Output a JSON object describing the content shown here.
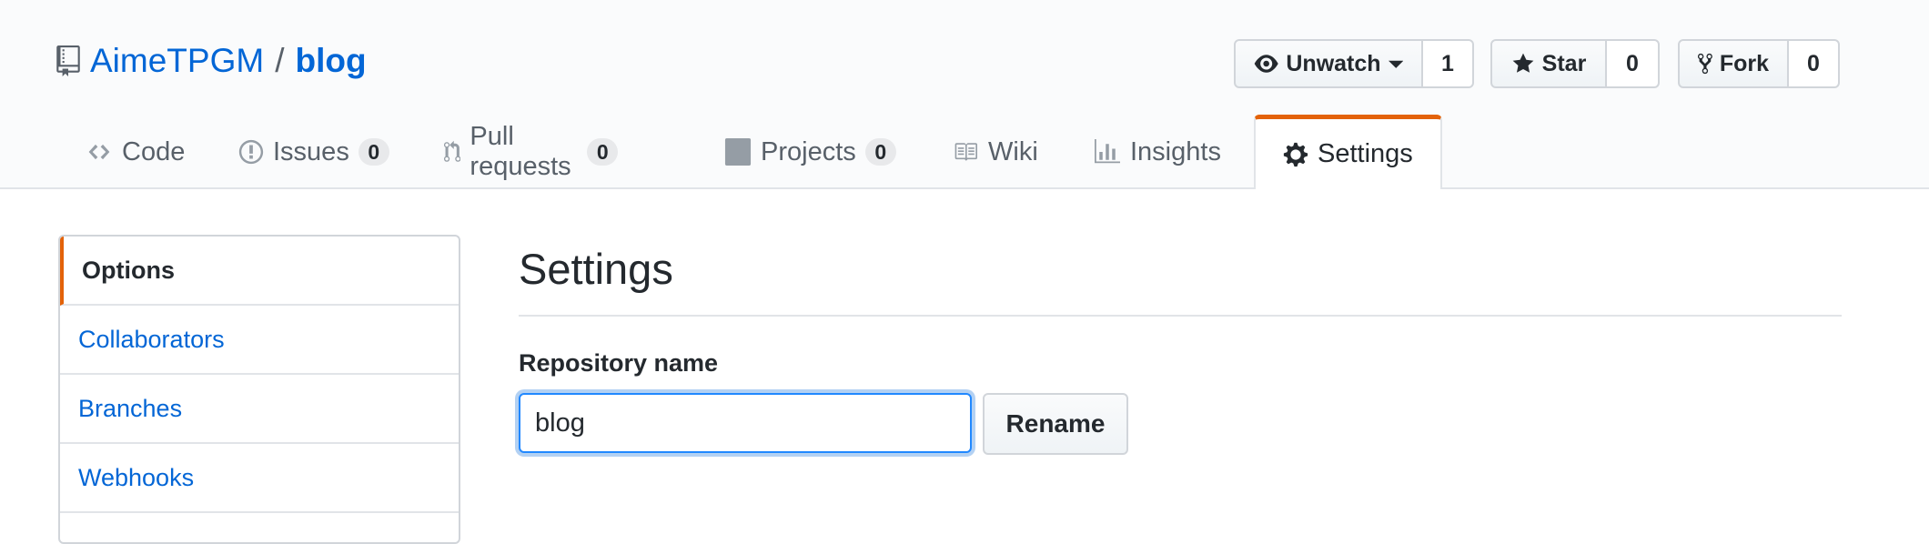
{
  "repo": {
    "owner": "AimeTPGM",
    "separator": "/",
    "name": "blog"
  },
  "actions": {
    "watch": {
      "label": "Unwatch",
      "count": "1"
    },
    "star": {
      "label": "Star",
      "count": "0"
    },
    "fork": {
      "label": "Fork",
      "count": "0"
    }
  },
  "tabs": [
    {
      "label": "Code",
      "icon": "code-icon"
    },
    {
      "label": "Issues",
      "count": "0",
      "icon": "issue-opened-icon"
    },
    {
      "label": "Pull requests",
      "count": "0",
      "icon": "git-pull-request-icon"
    },
    {
      "label": "Projects",
      "count": "0",
      "icon": "project-icon"
    },
    {
      "label": "Wiki",
      "icon": "book-icon"
    },
    {
      "label": "Insights",
      "icon": "graph-icon"
    },
    {
      "label": "Settings",
      "icon": "gear-icon",
      "selected": true
    }
  ],
  "menu": {
    "items": [
      {
        "label": "Options",
        "selected": true
      },
      {
        "label": "Collaborators"
      },
      {
        "label": "Branches"
      },
      {
        "label": "Webhooks"
      }
    ]
  },
  "settings": {
    "title": "Settings",
    "repo_name_label": "Repository name",
    "repo_name_value": "blog",
    "rename_label": "Rename"
  },
  "colors": {
    "link": "#0366d6",
    "accent": "#e36209",
    "focus": "#2188ff",
    "text": "#24292e"
  }
}
